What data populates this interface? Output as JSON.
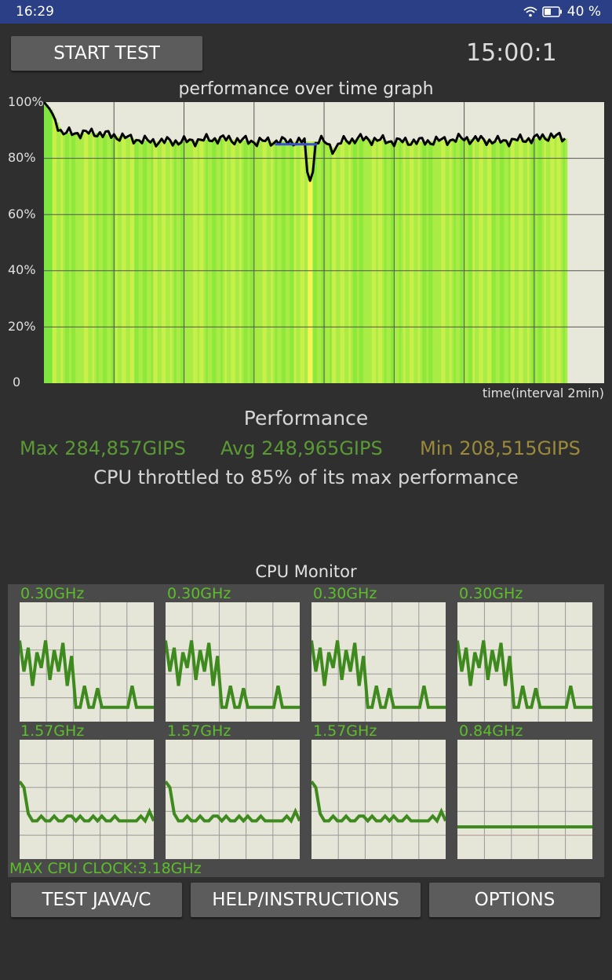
{
  "status_bar": {
    "time": "16:29",
    "battery": "40 %"
  },
  "header": {
    "start_button": "START TEST",
    "timer": "15:00:1"
  },
  "graph": {
    "title": "performance over time graph",
    "y_labels": [
      "100%",
      "80%",
      "60%",
      "40%",
      "20%",
      "0"
    ],
    "x_label": "time(interval 2min)"
  },
  "chart_data": {
    "type": "line",
    "title": "performance over time graph",
    "xlabel": "time(interval 2min)",
    "ylabel": "",
    "ylim": [
      0,
      100
    ],
    "x": [
      0,
      0.2,
      0.5,
      1,
      1.5,
      2,
      3,
      4,
      5,
      6,
      7,
      8,
      8.3,
      8.5,
      9,
      10,
      11,
      12,
      13,
      14,
      14.5,
      14.9
    ],
    "values": [
      100,
      97,
      89,
      89,
      89,
      88,
      86,
      86,
      87,
      86,
      86,
      86,
      83,
      86,
      87,
      86,
      86,
      87,
      86,
      87,
      88,
      87
    ],
    "dip": {
      "x": 7.6,
      "value": 72
    }
  },
  "performance": {
    "title": "Performance",
    "max": "Max 284,857GIPS",
    "avg": "Avg 248,965GIPS",
    "min": "Min 208,515GIPS",
    "throttle_text": "CPU throttled to 85% of its max performance"
  },
  "cpu_monitor": {
    "title": "CPU Monitor",
    "cores": [
      {
        "freq": "0.30GHz"
      },
      {
        "freq": "0.30GHz"
      },
      {
        "freq": "0.30GHz"
      },
      {
        "freq": "0.30GHz"
      },
      {
        "freq": "1.57GHz"
      },
      {
        "freq": "1.57GHz"
      },
      {
        "freq": "1.57GHz"
      },
      {
        "freq": "0.84GHz"
      }
    ],
    "max_clock": "MAX CPU CLOCK:3.18GHz"
  },
  "footer": {
    "test_button": "TEST JAVA/C",
    "help_button": "HELP/INSTRUCTIONS",
    "options_button": "OPTIONS"
  },
  "colors": {
    "line_green": "#3f8a1e",
    "freq_green": "#5cbf2a",
    "max_color": "#5a9a35",
    "avg_color": "#5a9a35",
    "min_color": "#9a8a3a"
  }
}
